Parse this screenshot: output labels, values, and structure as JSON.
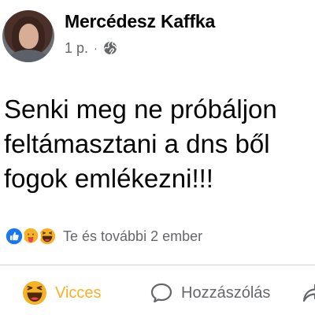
{
  "post": {
    "author": "Mercédesz Kaffka",
    "timestamp": "1 p.",
    "separator": "·",
    "audience_icon": "globe-icon",
    "text_lines": [
      "Senki meg ne próbáljon",
      "feltámasztani a dns ből",
      "fogok emlékezni!!!"
    ]
  },
  "reactions": {
    "icons": [
      "like-icon",
      "care-icon",
      "haha-icon"
    ],
    "summary": "Te és további 2 ember"
  },
  "actions": {
    "haha_label": "Vicces",
    "comment_label": "Hozzászólás",
    "share_icon": "share-icon"
  },
  "colors": {
    "like_blue": "#1877f2",
    "haha_yellow": "#f7b125",
    "secondary_text": "#65676b",
    "divider": "#ced0d4"
  }
}
